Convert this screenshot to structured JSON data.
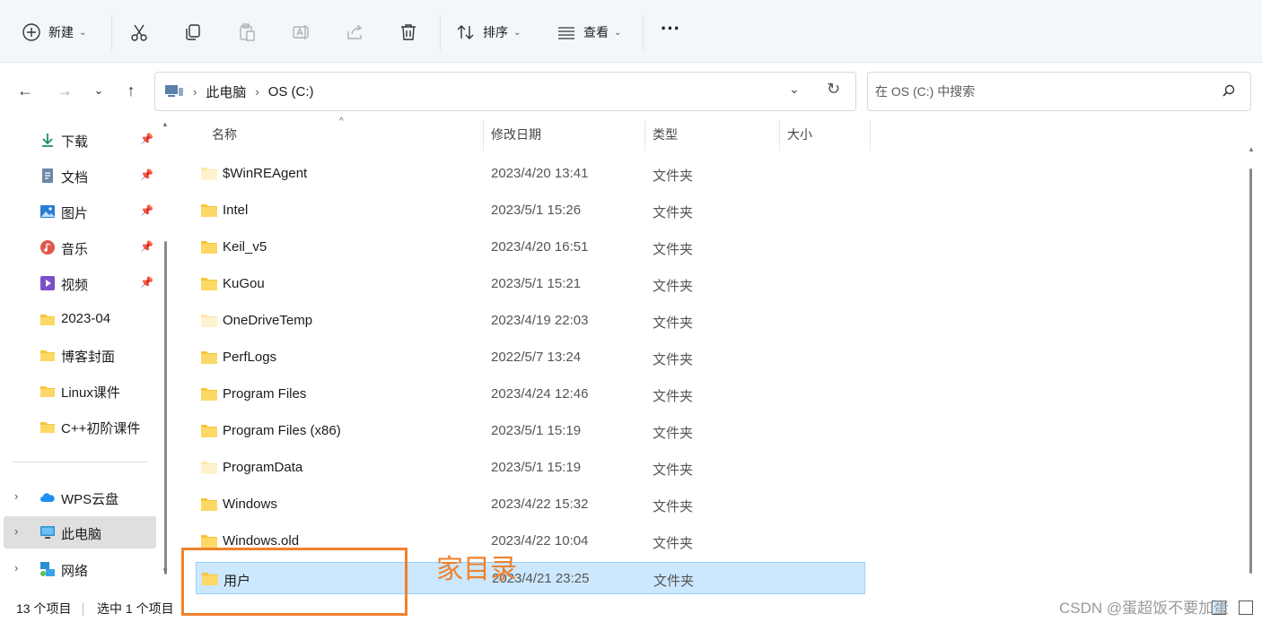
{
  "toolbar": {
    "new_label": "新建",
    "sort_label": "排序",
    "view_label": "查看",
    "more_label": "···"
  },
  "address": {
    "crumbs": [
      "此电脑",
      "OS (C:)"
    ],
    "separator": "›"
  },
  "search": {
    "placeholder": "在 OS (C:) 中搜索"
  },
  "sidebar": {
    "quick": [
      {
        "label": "下载",
        "icon": "download-icon",
        "pinned": true
      },
      {
        "label": "文档",
        "icon": "document-icon",
        "pinned": true
      },
      {
        "label": "图片",
        "icon": "picture-icon",
        "pinned": true
      },
      {
        "label": "音乐",
        "icon": "music-icon",
        "pinned": true
      },
      {
        "label": "视频",
        "icon": "video-icon",
        "pinned": true
      },
      {
        "label": "2023-04",
        "icon": "folder-icon",
        "pinned": false
      },
      {
        "label": "博客封面",
        "icon": "folder-icon",
        "pinned": false
      },
      {
        "label": "Linux课件",
        "icon": "folder-icon",
        "pinned": false
      },
      {
        "label": "C++初阶课件",
        "icon": "folder-icon",
        "pinned": false
      }
    ],
    "tree": [
      {
        "label": "WPS云盘",
        "icon": "cloud-icon",
        "selected": false
      },
      {
        "label": "此电脑",
        "icon": "computer-icon",
        "selected": true
      },
      {
        "label": "网络",
        "icon": "network-icon",
        "selected": false
      }
    ]
  },
  "columns": {
    "name": "名称",
    "modified": "修改日期",
    "type": "类型",
    "size": "大小"
  },
  "files": [
    {
      "name": "$WinREAgent",
      "modified": "2023/4/20 13:41",
      "type": "文件夹",
      "light": true
    },
    {
      "name": "Intel",
      "modified": "2023/5/1 15:26",
      "type": "文件夹",
      "light": false
    },
    {
      "name": "Keil_v5",
      "modified": "2023/4/20 16:51",
      "type": "文件夹",
      "light": false
    },
    {
      "name": "KuGou",
      "modified": "2023/5/1 15:21",
      "type": "文件夹",
      "light": false
    },
    {
      "name": "OneDriveTemp",
      "modified": "2023/4/19 22:03",
      "type": "文件夹",
      "light": true
    },
    {
      "name": "PerfLogs",
      "modified": "2022/5/7 13:24",
      "type": "文件夹",
      "light": false
    },
    {
      "name": "Program Files",
      "modified": "2023/4/24 12:46",
      "type": "文件夹",
      "light": false
    },
    {
      "name": "Program Files (x86)",
      "modified": "2023/5/1 15:19",
      "type": "文件夹",
      "light": false
    },
    {
      "name": "ProgramData",
      "modified": "2023/5/1 15:19",
      "type": "文件夹",
      "light": true
    },
    {
      "name": "Windows",
      "modified": "2023/4/22 15:32",
      "type": "文件夹",
      "light": false
    },
    {
      "name": "Windows.old",
      "modified": "2023/4/22 10:04",
      "type": "文件夹",
      "light": false
    },
    {
      "name": "用户",
      "modified": "2023/4/21 23:25",
      "type": "文件夹",
      "light": false,
      "selected": true
    }
  ],
  "status": {
    "count": "13 个项目",
    "selection": "选中 1 个项目"
  },
  "annotation": {
    "label": "家目录",
    "color": "#f0812c"
  },
  "watermark": "CSDN @蛋超饭不要加蛋",
  "colors": {
    "selection_bg": "#cce8ff",
    "selection_border": "#99d1ff",
    "folder": "#f8c537",
    "folder_light": "#fde7a3"
  }
}
